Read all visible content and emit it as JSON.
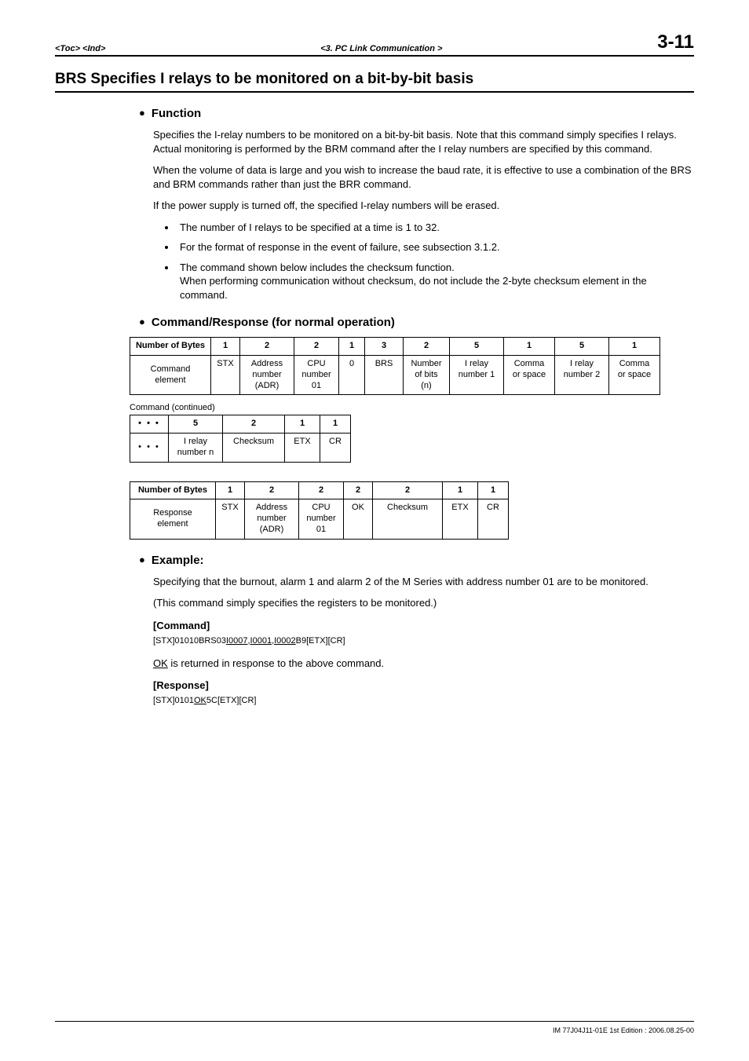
{
  "header": {
    "left": "<Toc> <Ind>",
    "center": "<3.  PC Link Communication >",
    "page": "3-11"
  },
  "title": "BRS   Specifies I relays to be monitored on a bit-by-bit basis",
  "h_function": "Function",
  "func_p1": "Specifies the I-relay numbers to be monitored on a bit-by-bit basis.  Note that this command simply specifies I relays. Actual monitoring is performed by the BRM command after the I relay numbers are specified by this command.",
  "func_p2": "When the volume of data is large and you wish to increase the baud rate, it is effective to use a combination of the BRS and BRM commands rather than just the BRR command.",
  "func_p3": "If the power supply is turned off, the specified I-relay numbers will be erased.",
  "func_li1": "The number of I relays to be specified at a time is 1 to 32.",
  "func_li2": "For the format of response in the event of failure, see subsection 3.1.2.",
  "func_li3": "The command shown below includes the checksum function.\nWhen performing communication without checksum, do not include the 2-byte checksum element in the command.",
  "h_cmdresp": "Command/Response (for normal operation)",
  "t1": {
    "h0": "Number of Bytes",
    "h1": "1",
    "h2": "2",
    "h3": "2",
    "h4": "1",
    "h5": "3",
    "h6": "2",
    "h7": "5",
    "h8": "1",
    "h9": "5",
    "h10": "1",
    "r0": "Command\nelement",
    "r1": "STX",
    "r2": "Address\nnumber\n(ADR)",
    "r3": "CPU\nnumber\n01",
    "r4": "0",
    "r5": "BRS",
    "r6": "Number\nof bits\n(n)",
    "r7": "I relay\nnumber 1",
    "r8": "Comma\nor space",
    "r9": "I relay\nnumber 2",
    "r10": "Comma\nor space"
  },
  "t1note": "Command (continued)",
  "t2": {
    "h0": "• • •",
    "h1": "5",
    "h2": "2",
    "h3": "1",
    "h4": "1",
    "r0": "• • •",
    "r1": "I relay\nnumber n",
    "r2": "Checksum",
    "r3": "ETX",
    "r4": "CR"
  },
  "t3": {
    "h0": "Number of Bytes",
    "h1": "1",
    "h2": "2",
    "h3": "2",
    "h4": "2",
    "h5": "2",
    "h6": "1",
    "h7": "1",
    "r0": "Response\nelement",
    "r1": "STX",
    "r2": "Address\nnumber\n(ADR)",
    "r3": "CPU\nnumber\n01",
    "r4": "OK",
    "r5": "Checksum",
    "r6": "ETX",
    "r7": "CR"
  },
  "h_example": "Example:",
  "ex_p1": "Specifying that the burnout, alarm 1 and  alarm 2 of the M Series with address number 01 are to be monitored.",
  "ex_p2": "(This command simply specifies the registers to be monitored.)",
  "ex_cmd_h": "[Command]",
  "ex_cmd_pre": "[STX]01010BRS03",
  "ex_cmd_u": "I0007,I0001,I0002",
  "ex_cmd_post": "B9[ETX][CR]",
  "ex_ok_pre": "",
  "ex_ok_u": "OK",
  "ex_ok_post": " is returned in response to the above command.",
  "ex_resp_h": "[Response]",
  "ex_resp_pre": "[STX]0101",
  "ex_resp_u": "OK",
  "ex_resp_post": "5C[ETX][CR]",
  "footer": "IM 77J04J11-01E  1st Edition : 2006.08.25-00"
}
